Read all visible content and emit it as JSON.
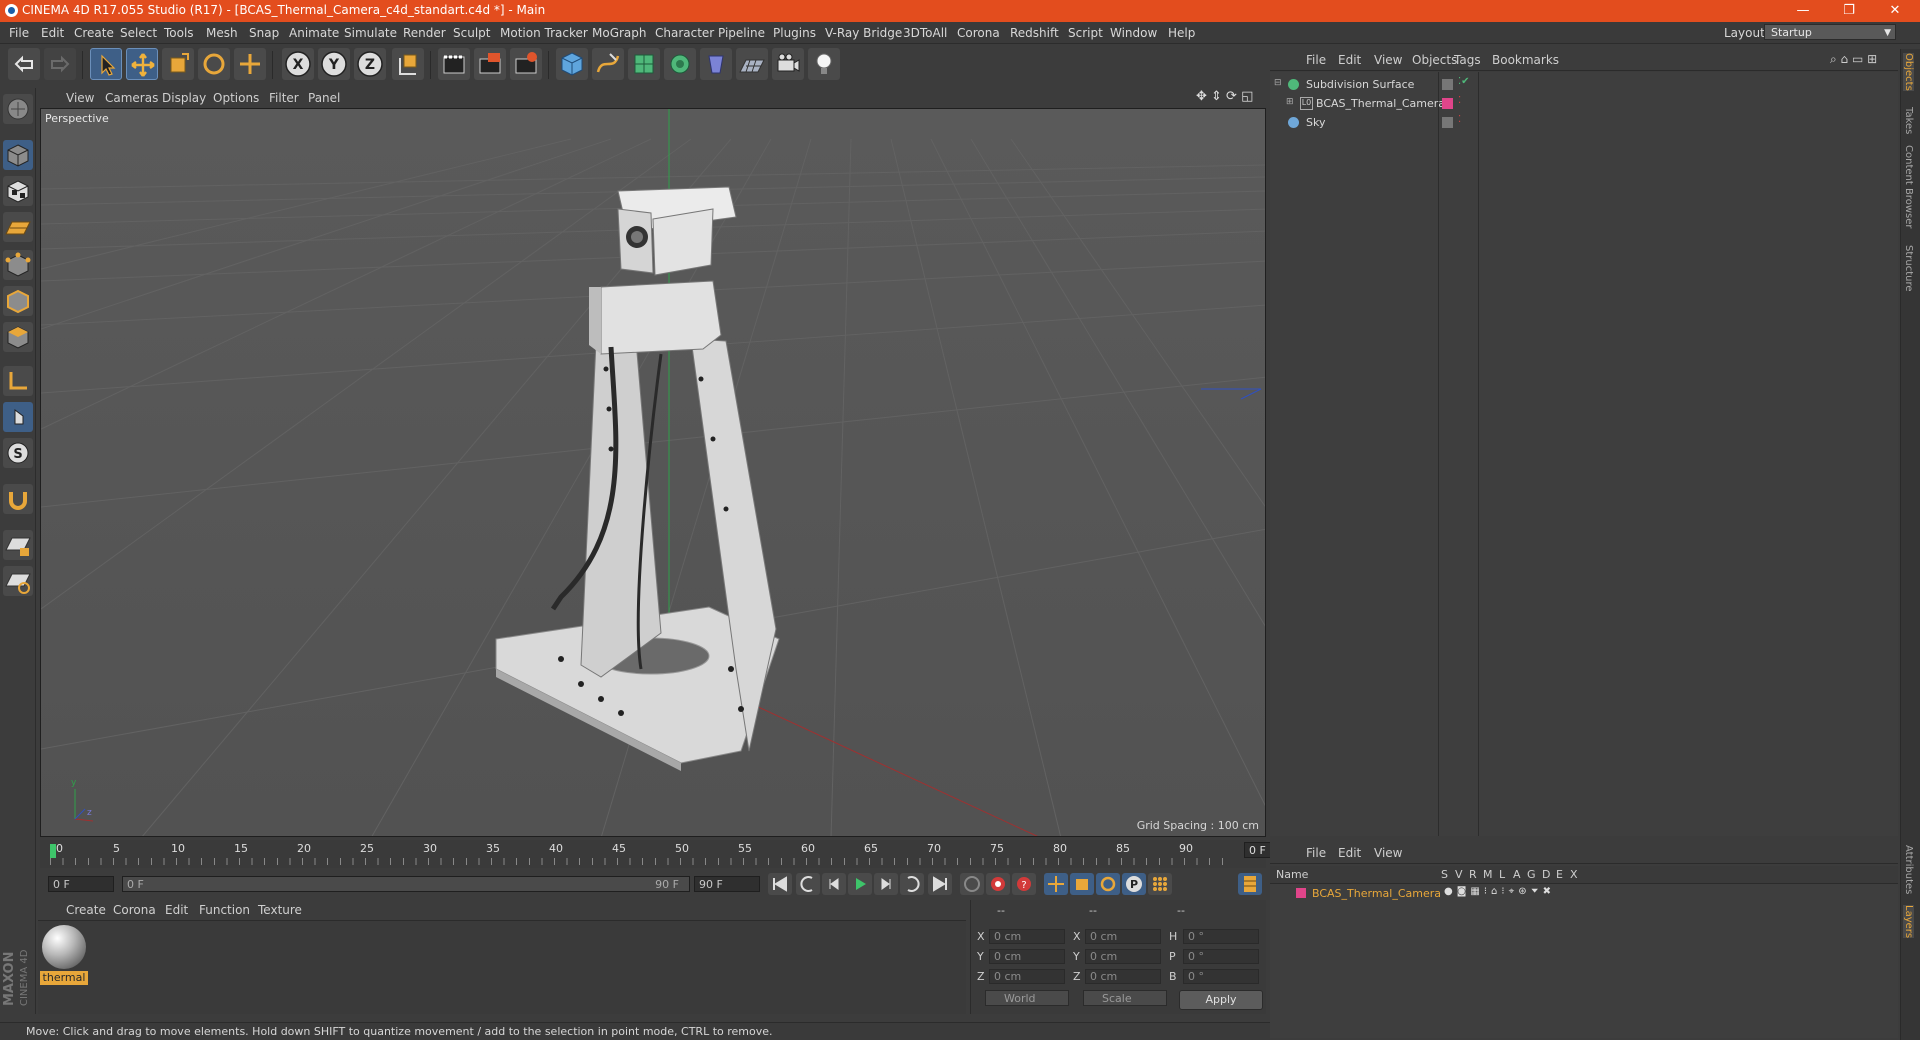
{
  "window": {
    "title": "CINEMA 4D R17.055 Studio (R17) - [BCAS_Thermal_Camera_c4d_standart.c4d *] - Main",
    "controls": {
      "minimize": "—",
      "restore": "❐",
      "close": "✕"
    }
  },
  "menubar": {
    "items": [
      "File",
      "Edit",
      "Create",
      "Select",
      "Tools",
      "Mesh",
      "Snap",
      "Animate",
      "Simulate",
      "Render",
      "Sculpt",
      "Motion Tracker",
      "MoGraph",
      "Character",
      "Pipeline",
      "Plugins",
      "V-Ray Bridge",
      "3DToAll",
      "Corona",
      "Redshift",
      "Script",
      "Window",
      "Help"
    ],
    "layout_label": "Layout:",
    "layout_value": "Startup"
  },
  "toolbar": {
    "icons": [
      "undo-icon",
      "redo-icon",
      "select-arrow-icon",
      "move-icon",
      "scale-icon",
      "rotate-icon",
      "live-select-icon",
      "x-axis-icon",
      "y-axis-icon",
      "z-axis-icon",
      "coordinate-system-icon",
      "render-view-icon",
      "render-picture-viewer-icon",
      "edit-render-settings-icon",
      "cube-primitive-icon",
      "pen-spline-icon",
      "subdivision-surface-icon",
      "cloner-icon",
      "deformer-icon",
      "floor-icon",
      "camera-icon",
      "light-icon"
    ],
    "axis_labels": [
      "X",
      "Y",
      "Z"
    ]
  },
  "viewport": {
    "menu": [
      "View",
      "Cameras",
      "Display",
      "Options",
      "Filter",
      "Panel"
    ],
    "label": "Perspective",
    "grid_spacing": "Grid Spacing : 100 cm"
  },
  "timeline": {
    "ticks": [
      "0",
      "5",
      "10",
      "15",
      "20",
      "25",
      "30",
      "35",
      "40",
      "45",
      "50",
      "55",
      "60",
      "65",
      "70",
      "75",
      "80",
      "85",
      "90"
    ],
    "current_frame": "0 F",
    "start_field": "0 F",
    "slider_start": "0 F",
    "slider_end": "90 F",
    "end_field": "90 F"
  },
  "material_manager": {
    "menu": [
      "Create",
      "Corona",
      "Edit",
      "Function",
      "Texture"
    ],
    "materials": [
      {
        "name": "thermal"
      }
    ]
  },
  "coordinates": {
    "headers": [
      "--",
      "--",
      "--"
    ],
    "rows": [
      {
        "pos_label": "X",
        "pos": "0 cm",
        "size_label": "X",
        "size": "0 cm",
        "rot_label": "H",
        "rot": "0 °"
      },
      {
        "pos_label": "Y",
        "pos": "0 cm",
        "size_label": "Y",
        "size": "0 cm",
        "rot_label": "P",
        "rot": "0 °"
      },
      {
        "pos_label": "Z",
        "pos": "0 cm",
        "size_label": "Z",
        "size": "0 cm",
        "rot_label": "B",
        "rot": "0 °"
      }
    ],
    "mode_world": "World",
    "mode_scale": "Scale",
    "apply_label": "Apply"
  },
  "status_bar": {
    "text": "Move: Click and drag to move elements. Hold down SHIFT to quantize movement / add to the selection in point mode, CTRL to remove."
  },
  "object_manager": {
    "menu": [
      "File",
      "Edit",
      "View",
      "Objects",
      "Tags",
      "Bookmarks"
    ],
    "objects": [
      {
        "name": "Subdivision Surface",
        "color": "#4fb87a"
      },
      {
        "name": "BCAS_Thermal_Camera",
        "color": "#aaaaaa"
      },
      {
        "name": "Sky",
        "color": "#6fa7d8"
      }
    ]
  },
  "layer_manager": {
    "menu": [
      "File",
      "Edit",
      "View"
    ],
    "header_name": "Name",
    "header_cols": [
      "S",
      "V",
      "R",
      "M",
      "L",
      "A",
      "G",
      "D",
      "E",
      "X"
    ],
    "layers": [
      {
        "name": "BCAS_Thermal_Camera",
        "color": "#e0458a"
      }
    ]
  },
  "right_tabs": [
    "Objects",
    "Takes",
    "Content Browser",
    "Structure",
    "Attributes",
    "Layers"
  ],
  "brand": {
    "maxon": "MAXON",
    "product": "CINEMA 4D"
  },
  "colors": {
    "titlebar": "#e34d1e",
    "selection": "#e8a73a",
    "highlight": "#3e5f87"
  }
}
